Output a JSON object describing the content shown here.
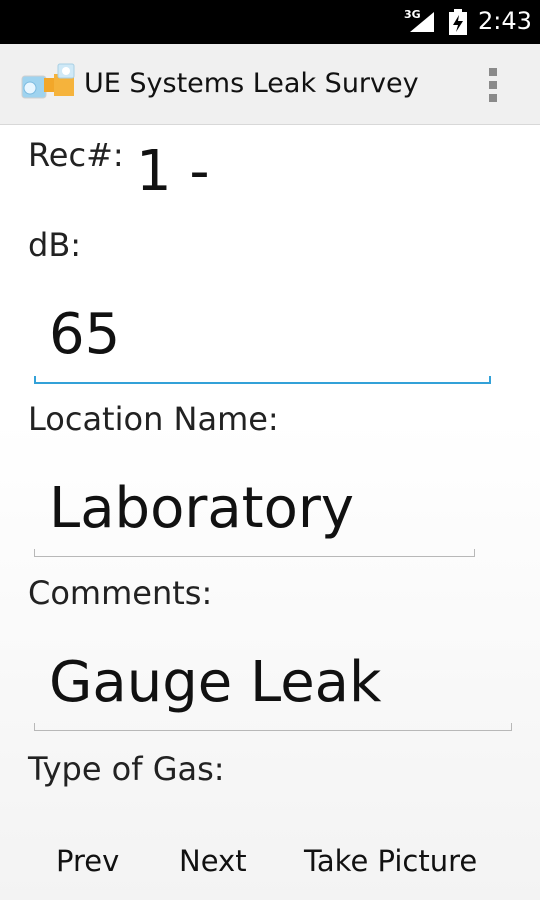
{
  "status_bar": {
    "network": "3G",
    "time": "2:43",
    "icons": [
      "signal-icon",
      "battery-charging-icon"
    ]
  },
  "action_bar": {
    "title": "UE Systems Leak Survey",
    "icons": [
      "app-logo-icon",
      "overflow-menu-icon"
    ]
  },
  "form": {
    "rec_label": "Rec#:",
    "rec_value": "1 -",
    "db_label": "dB:",
    "db_value": "65",
    "location_label": "Location Name:",
    "location_value": "Laboratory",
    "comments_label": "Comments:",
    "comments_value": "Gauge Leak",
    "gas_label": "Type of Gas:"
  },
  "buttons": {
    "prev": "Prev",
    "next": "Next",
    "take_picture": "Take Picture"
  },
  "colors": {
    "status_bar": "#000000",
    "action_bar": "#f0f0f0",
    "focus_accent": "#33a1d8"
  }
}
